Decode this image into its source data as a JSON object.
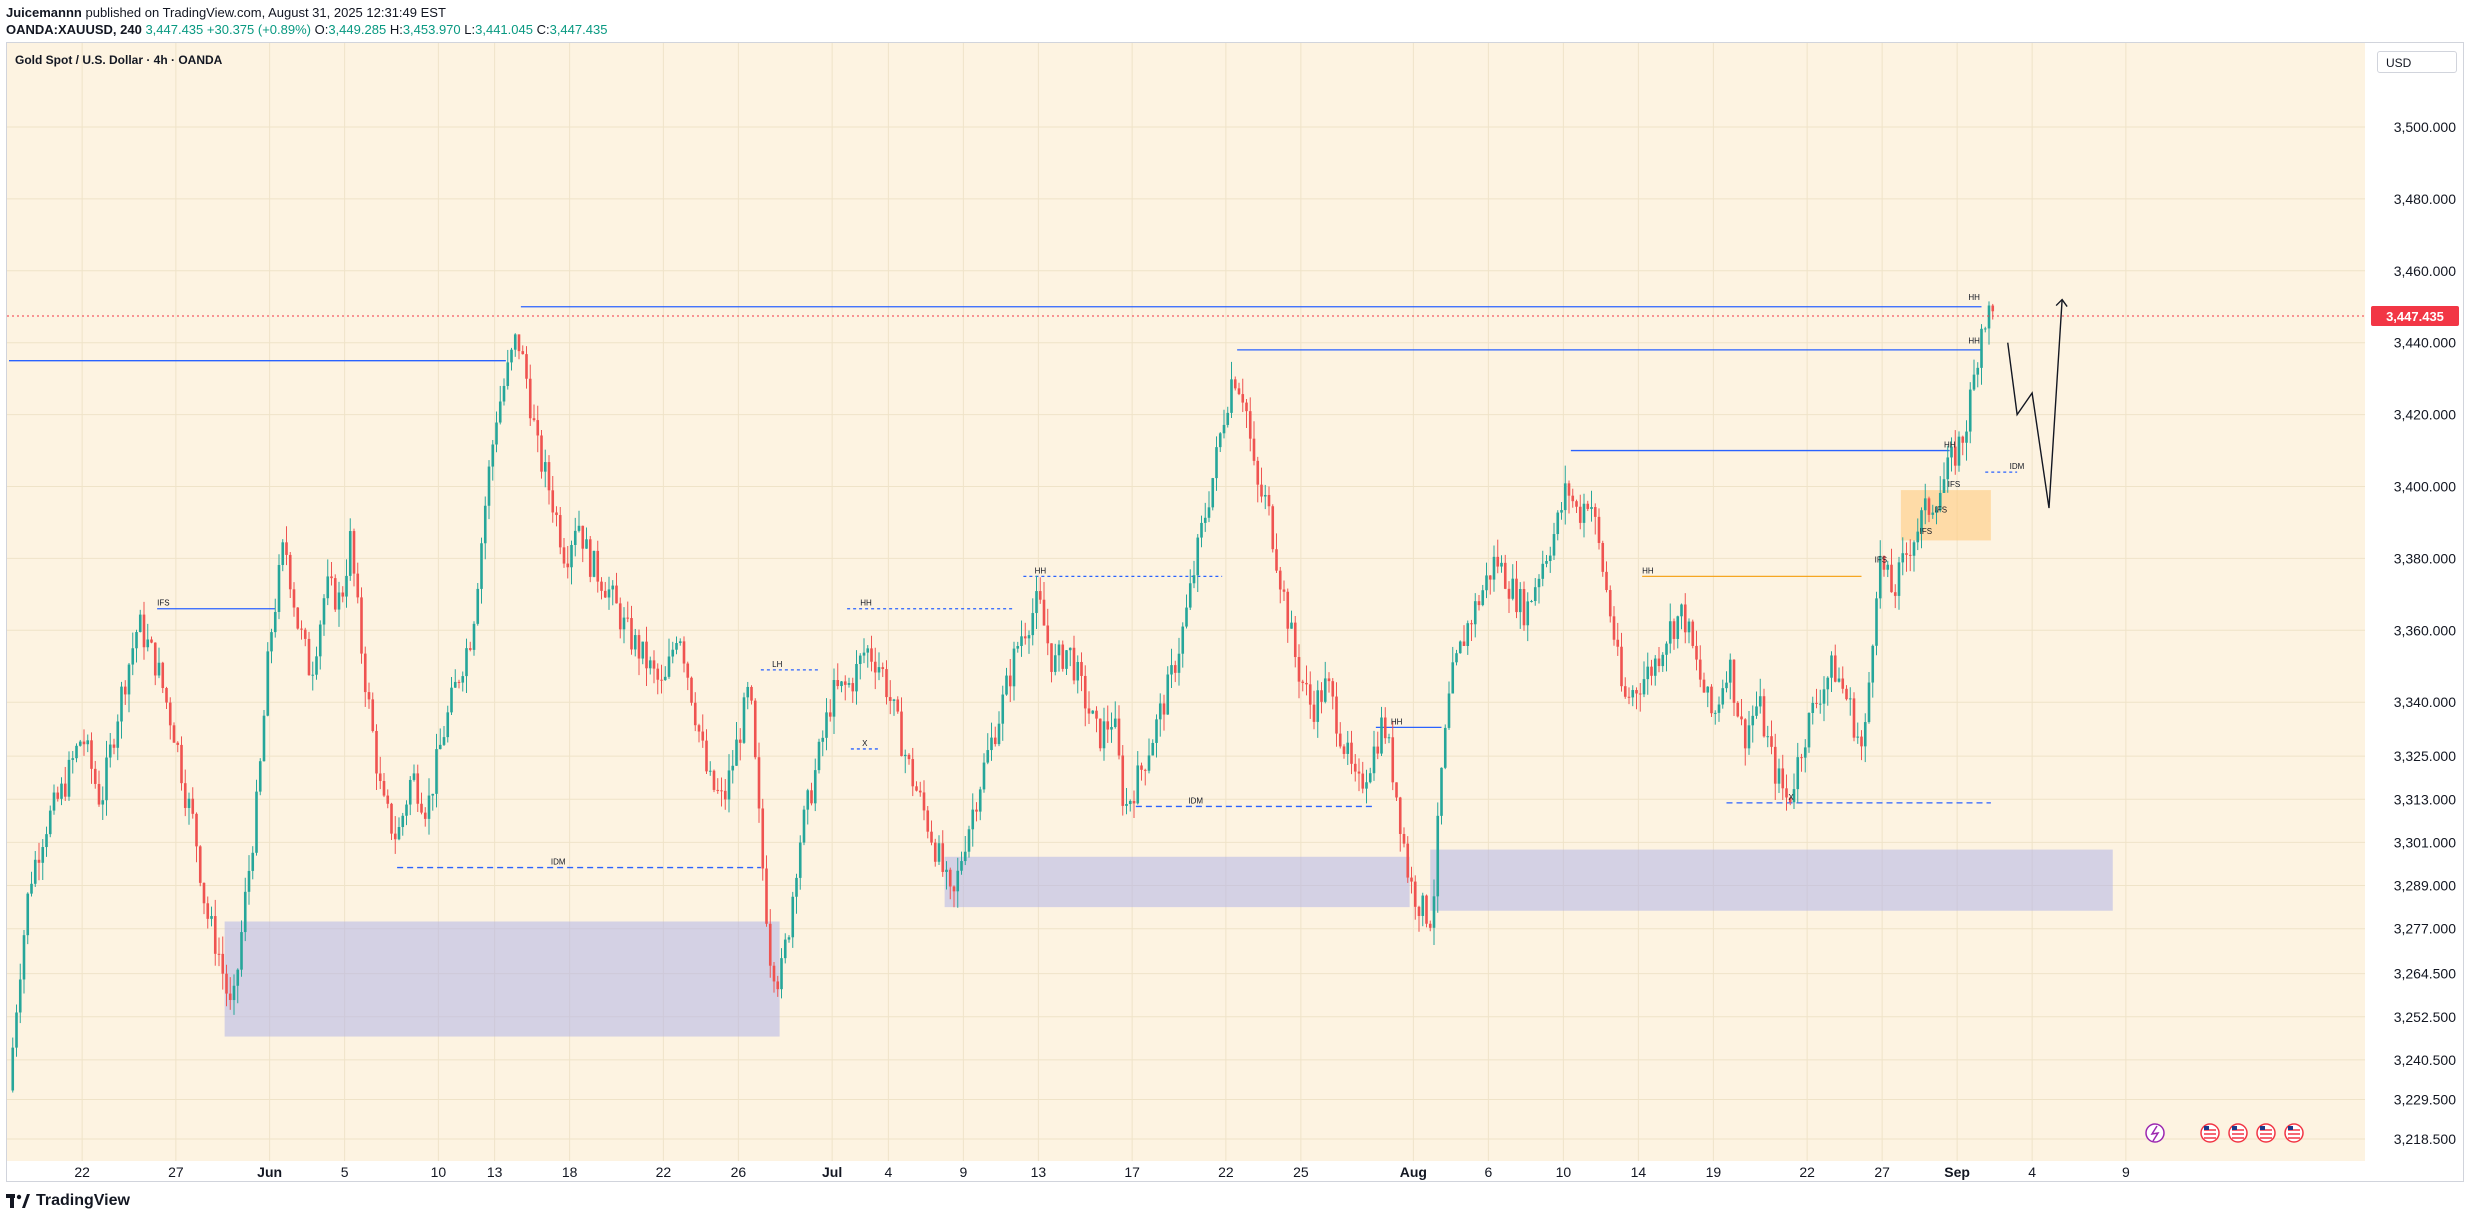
{
  "header": {
    "author": "Juicemannn",
    "published": "published on TradingView.com, August 31, 2025 12:31:49 EST",
    "symbol": "OANDA:XAUUSD, 240",
    "last": "3,447.435",
    "change": "+30.375 (+0.89%)",
    "o_label": "O:",
    "o": "3,449.285",
    "h_label": "H:",
    "h": "3,453.970",
    "l_label": "L:",
    "l": "3,441.045",
    "c_label": "C:",
    "c": "3,447.435"
  },
  "chart_title": "Gold Spot / U.S. Dollar · 4h · OANDA",
  "currency": "USD",
  "footer": {
    "brand": "TradingView"
  },
  "colors": {
    "background": "#fdf3e1",
    "up": "#26a69a",
    "down": "#ef5350",
    "level": "#2962ff",
    "zone_blue": "#b2b5e8",
    "zone_orange": "#ffcc80",
    "price_tag": "#f23645"
  },
  "icons": [
    "lightning-icon",
    "us-flag-icon",
    "us-flag-icon",
    "us-flag-icon",
    "us-flag-icon"
  ],
  "chart_data": {
    "type": "candlestick",
    "title": "Gold Spot / U.S. Dollar · 4h · OANDA",
    "ylim": [
      3212,
      3512
    ],
    "grid": true,
    "current_price": 3447.435,
    "current_price_label": "3,447.435",
    "y_ticks": [
      {
        "v": 3500,
        "label": "3,500.000"
      },
      {
        "v": 3480,
        "label": "3,480.000"
      },
      {
        "v": 3460,
        "label": "3,460.000"
      },
      {
        "v": 3440,
        "label": "3,440.000"
      },
      {
        "v": 3420,
        "label": "3,420.000"
      },
      {
        "v": 3400,
        "label": "3,400.000"
      },
      {
        "v": 3380,
        "label": "3,380.000"
      },
      {
        "v": 3360,
        "label": "3,360.000"
      },
      {
        "v": 3340,
        "label": "3,340.000"
      },
      {
        "v": 3325,
        "label": "3,325.000"
      },
      {
        "v": 3313,
        "label": "3,313.000"
      },
      {
        "v": 3301,
        "label": "3,301.000"
      },
      {
        "v": 3289,
        "label": "3,289.000"
      },
      {
        "v": 3277,
        "label": "3,277.000"
      },
      {
        "v": 3264.5,
        "label": "3,264.500"
      },
      {
        "v": 3252.5,
        "label": "3,252.500"
      },
      {
        "v": 3240.5,
        "label": "3,240.500"
      },
      {
        "v": 3229.5,
        "label": "3,229.500"
      },
      {
        "v": 3218.5,
        "label": "3,218.500"
      }
    ],
    "x_ticks": [
      {
        "d": 22,
        "label": "22",
        "bold": false
      },
      {
        "d": 27,
        "label": "27",
        "bold": false
      },
      {
        "d": 32,
        "label": "Jun",
        "bold": true
      },
      {
        "d": 36,
        "label": "5",
        "bold": false
      },
      {
        "d": 41,
        "label": "10",
        "bold": false
      },
      {
        "d": 44,
        "label": "13",
        "bold": false
      },
      {
        "d": 48,
        "label": "18",
        "bold": false
      },
      {
        "d": 53,
        "label": "22",
        "bold": false
      },
      {
        "d": 57,
        "label": "26",
        "bold": false
      },
      {
        "d": 62,
        "label": "Jul",
        "bold": true
      },
      {
        "d": 65,
        "label": "4",
        "bold": false
      },
      {
        "d": 69,
        "label": "9",
        "bold": false
      },
      {
        "d": 73,
        "label": "13",
        "bold": false
      },
      {
        "d": 78,
        "label": "17",
        "bold": false
      },
      {
        "d": 83,
        "label": "22",
        "bold": false
      },
      {
        "d": 87,
        "label": "25",
        "bold": false
      },
      {
        "d": 93,
        "label": "Aug",
        "bold": true
      },
      {
        "d": 97,
        "label": "6",
        "bold": false
      },
      {
        "d": 101,
        "label": "10",
        "bold": false
      },
      {
        "d": 105,
        "label": "14",
        "bold": false
      },
      {
        "d": 109,
        "label": "19",
        "bold": false
      },
      {
        "d": 114,
        "label": "22",
        "bold": false
      },
      {
        "d": 118,
        "label": "27",
        "bold": false
      },
      {
        "d": 122,
        "label": "Sep",
        "bold": true
      },
      {
        "d": 126,
        "label": "4",
        "bold": false
      },
      {
        "d": 131,
        "label": "9",
        "bold": false
      }
    ],
    "close_path": [
      [
        18.1,
        3232
      ],
      [
        18.6,
        3262
      ],
      [
        19.2,
        3290
      ],
      [
        20,
        3305
      ],
      [
        21,
        3316
      ],
      [
        22,
        3331
      ],
      [
        23,
        3312
      ],
      [
        24,
        3340
      ],
      [
        25,
        3362
      ],
      [
        26,
        3350
      ],
      [
        27,
        3330
      ],
      [
        27.5,
        3315
      ],
      [
        28,
        3305
      ],
      [
        28.6,
        3282
      ],
      [
        29.3,
        3270
      ],
      [
        30,
        3252
      ],
      [
        30.7,
        3285
      ],
      [
        31.4,
        3315
      ],
      [
        32,
        3357
      ],
      [
        32.8,
        3385
      ],
      [
        33.5,
        3362
      ],
      [
        34.2,
        3348
      ],
      [
        35,
        3372
      ],
      [
        35.8,
        3368
      ],
      [
        36.3,
        3385
      ],
      [
        37,
        3350
      ],
      [
        38,
        3312
      ],
      [
        38.8,
        3302
      ],
      [
        39.6,
        3320
      ],
      [
        40.4,
        3310
      ],
      [
        41.2,
        3330
      ],
      [
        42,
        3346
      ],
      [
        42.8,
        3360
      ],
      [
        43.6,
        3400
      ],
      [
        44.1,
        3420
      ],
      [
        44.6,
        3430
      ],
      [
        45.2,
        3442
      ],
      [
        45.7,
        3430
      ],
      [
        46.3,
        3410
      ],
      [
        47,
        3398
      ],
      [
        47.8,
        3380
      ],
      [
        48.4,
        3392
      ],
      [
        49,
        3380
      ],
      [
        50,
        3372
      ],
      [
        51,
        3360
      ],
      [
        52,
        3352
      ],
      [
        53,
        3343
      ],
      [
        53.8,
        3362
      ],
      [
        54.6,
        3340
      ],
      [
        55.4,
        3318
      ],
      [
        56.2,
        3312
      ],
      [
        57,
        3330
      ],
      [
        57.6,
        3344
      ],
      [
        58.2,
        3300
      ],
      [
        58.7,
        3270
      ],
      [
        59.2,
        3262
      ],
      [
        59.7,
        3278
      ],
      [
        60.2,
        3300
      ],
      [
        61,
        3318
      ],
      [
        62,
        3342
      ],
      [
        63,
        3345
      ],
      [
        63.8,
        3355
      ],
      [
        64.6,
        3350
      ],
      [
        65.4,
        3335
      ],
      [
        66.2,
        3320
      ],
      [
        67,
        3308
      ],
      [
        67.8,
        3295
      ],
      [
        68.4,
        3283
      ],
      [
        69,
        3300
      ],
      [
        70,
        3320
      ],
      [
        71,
        3338
      ],
      [
        72,
        3358
      ],
      [
        73,
        3368
      ],
      [
        73.8,
        3350
      ],
      [
        74.6,
        3355
      ],
      [
        75.4,
        3342
      ],
      [
        76.2,
        3330
      ],
      [
        77,
        3336
      ],
      [
        77.6,
        3310
      ],
      [
        78.4,
        3320
      ],
      [
        79.2,
        3332
      ],
      [
        80,
        3345
      ],
      [
        80.8,
        3362
      ],
      [
        81.6,
        3385
      ],
      [
        82.4,
        3405
      ],
      [
        82.9,
        3420
      ],
      [
        83.4,
        3432
      ],
      [
        84,
        3425
      ],
      [
        84.6,
        3400
      ],
      [
        85.2,
        3395
      ],
      [
        86,
        3372
      ],
      [
        86.8,
        3350
      ],
      [
        87.6,
        3338
      ],
      [
        88.4,
        3345
      ],
      [
        89.2,
        3330
      ],
      [
        90,
        3315
      ],
      [
        90.8,
        3325
      ],
      [
        91.4,
        3335
      ],
      [
        92,
        3318
      ],
      [
        92.8,
        3290
      ],
      [
        93.5,
        3282
      ],
      [
        94,
        3280
      ],
      [
        94.5,
        3320
      ],
      [
        95,
        3345
      ],
      [
        95.8,
        3360
      ],
      [
        96.6,
        3370
      ],
      [
        97.4,
        3380
      ],
      [
        98.2,
        3372
      ],
      [
        99,
        3365
      ],
      [
        99.8,
        3378
      ],
      [
        100.6,
        3388
      ],
      [
        101.2,
        3400
      ],
      [
        101.8,
        3392
      ],
      [
        102.4,
        3398
      ],
      [
        103,
        3380
      ],
      [
        103.6,
        3362
      ],
      [
        104.2,
        3340
      ],
      [
        105,
        3345
      ],
      [
        105.8,
        3350
      ],
      [
        106.6,
        3360
      ],
      [
        107.4,
        3365
      ],
      [
        108.2,
        3348
      ],
      [
        109,
        3335
      ],
      [
        109.8,
        3352
      ],
      [
        110.6,
        3330
      ],
      [
        111.4,
        3340
      ],
      [
        112.2,
        3322
      ],
      [
        113,
        3312
      ],
      [
        113.8,
        3330
      ],
      [
        114.6,
        3342
      ],
      [
        115.4,
        3350
      ],
      [
        116.2,
        3340
      ],
      [
        117,
        3325
      ],
      [
        117.8,
        3380
      ],
      [
        118.6,
        3370
      ],
      [
        119.4,
        3383
      ],
      [
        120.2,
        3392
      ],
      [
        121,
        3398
      ],
      [
        121.8,
        3408
      ],
      [
        122.4,
        3415
      ],
      [
        122.9,
        3430
      ],
      [
        123.3,
        3445
      ],
      [
        123.6,
        3448
      ],
      [
        123.9,
        3447.4
      ]
    ],
    "annotations": [
      {
        "text": "IFS",
        "d": 26.0,
        "p": 3366
      },
      {
        "text": "IDM",
        "d": 47.0,
        "p": 3294
      },
      {
        "text": "LH",
        "d": 58.8,
        "p": 3349
      },
      {
        "text": "HH",
        "d": 63.5,
        "p": 3366
      },
      {
        "text": "X",
        "d": 63.6,
        "p": 3327
      },
      {
        "text": "HH",
        "d": 72.8,
        "p": 3375
      },
      {
        "text": "IDM",
        "d": 81.0,
        "p": 3311
      },
      {
        "text": "HH",
        "d": 91.8,
        "p": 3333
      },
      {
        "text": "HH",
        "d": 105.2,
        "p": 3375
      },
      {
        "text": "X",
        "d": 113.0,
        "p": 3312
      },
      {
        "text": "IFS",
        "d": 117.6,
        "p": 3378
      },
      {
        "text": "IFS",
        "d": 120.0,
        "p": 3386
      },
      {
        "text": "IFS",
        "d": 120.8,
        "p": 3392
      },
      {
        "text": "IFS",
        "d": 121.5,
        "p": 3399
      },
      {
        "text": "HH",
        "d": 121.3,
        "p": 3410
      },
      {
        "text": "IDM",
        "d": 124.8,
        "p": 3404
      },
      {
        "text": "HH",
        "d": 122.6,
        "p": 3439
      },
      {
        "text": "HH",
        "d": 122.6,
        "p": 3451
      }
    ]
  }
}
